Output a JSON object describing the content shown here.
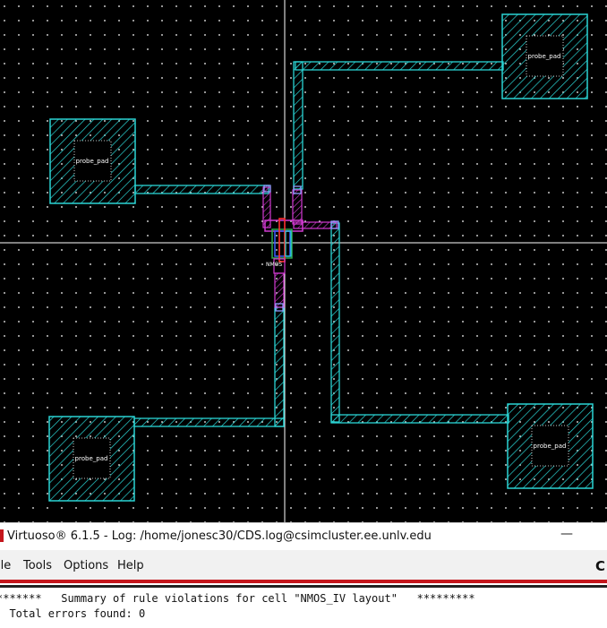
{
  "window": {
    "title": "Virtuoso® 6.1.5 - Log: /home/jonesc30/CDS.log@csimcluster.ee.unlv.edu",
    "minimize_glyph": "—"
  },
  "menu": {
    "items": [
      "ile",
      "Tools",
      "Options",
      "Help"
    ],
    "brand_letter": "C"
  },
  "log": {
    "lines": [
      "*******   Summary of rule violations for cell \"NMOS_IV layout\"   *********",
      "  Total errors found: 0"
    ]
  },
  "layout": {
    "pad_labels": [
      "probe_pad",
      "probe_pad",
      "probe_pad",
      "probe_pad"
    ],
    "device_label": "NMOS",
    "colors": {
      "background": "#000000",
      "grid_dot": "#ffffff",
      "axis": "#ffffff",
      "metal1": "#2ad4d4",
      "poly": "#d23ad2",
      "active": "#2fa84f",
      "gate": "#ff3030",
      "nwell": "#3a5cff"
    }
  }
}
